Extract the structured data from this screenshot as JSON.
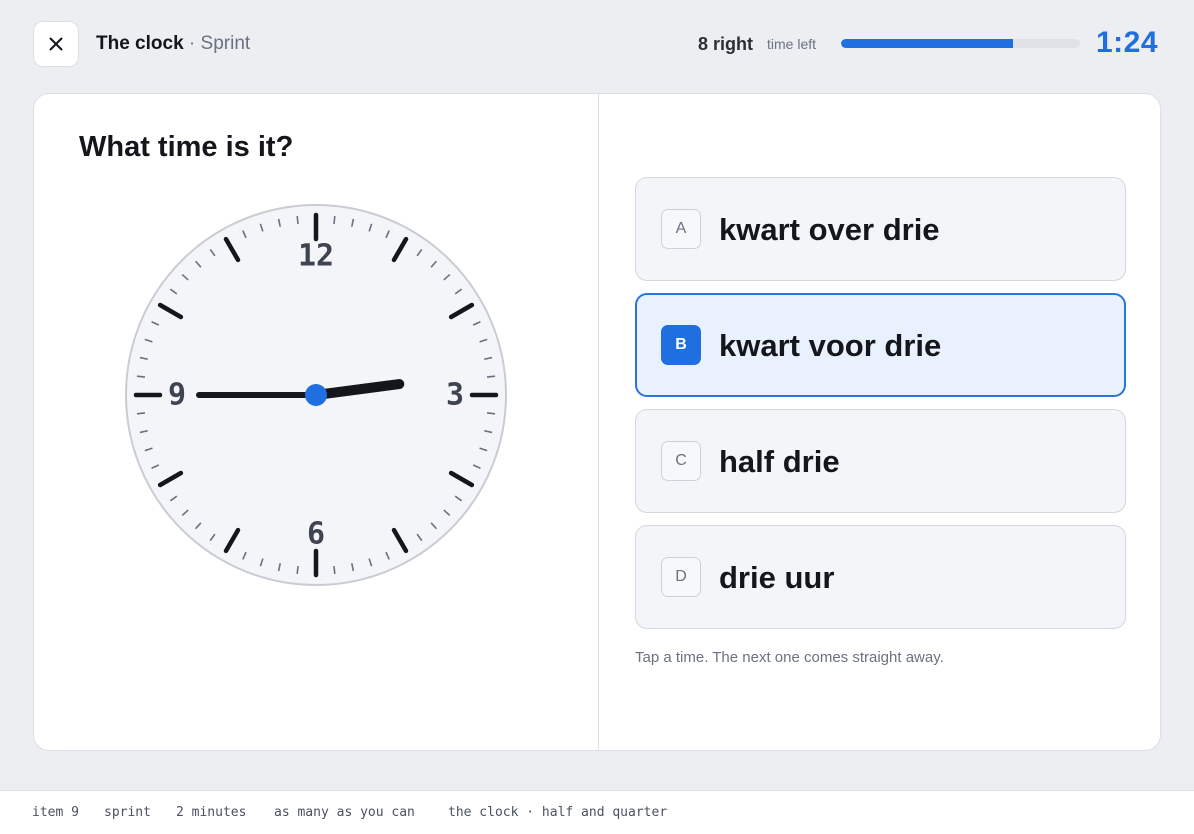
{
  "header": {
    "title": "The clock",
    "mode": " · Sprint",
    "score": "8 right",
    "time_left_label": "time left",
    "progress_fraction": 0.72,
    "timer": "1:24"
  },
  "question": {
    "prompt": "What time is it?",
    "clock": {
      "hour": 2,
      "minute": 45,
      "numerals": [
        "12",
        "3",
        "6",
        "9"
      ]
    }
  },
  "options": [
    {
      "letter": "A",
      "label": "kwart over drie",
      "selected": false
    },
    {
      "letter": "B",
      "label": "kwart voor drie",
      "selected": true
    },
    {
      "letter": "C",
      "label": "half drie",
      "selected": false
    },
    {
      "letter": "D",
      "label": "drie uur",
      "selected": false
    }
  ],
  "hint": "Tap a time. The next one comes straight away.",
  "footer": {
    "item": "item 9",
    "mode": "sprint",
    "duration": "2 minutes",
    "goal": "as many as you can",
    "topic": "the clock · half and quarter"
  },
  "colors": {
    "accent": "#1f6fe0",
    "selected_bg": "#e8f1fd",
    "hand": "#14161b"
  }
}
